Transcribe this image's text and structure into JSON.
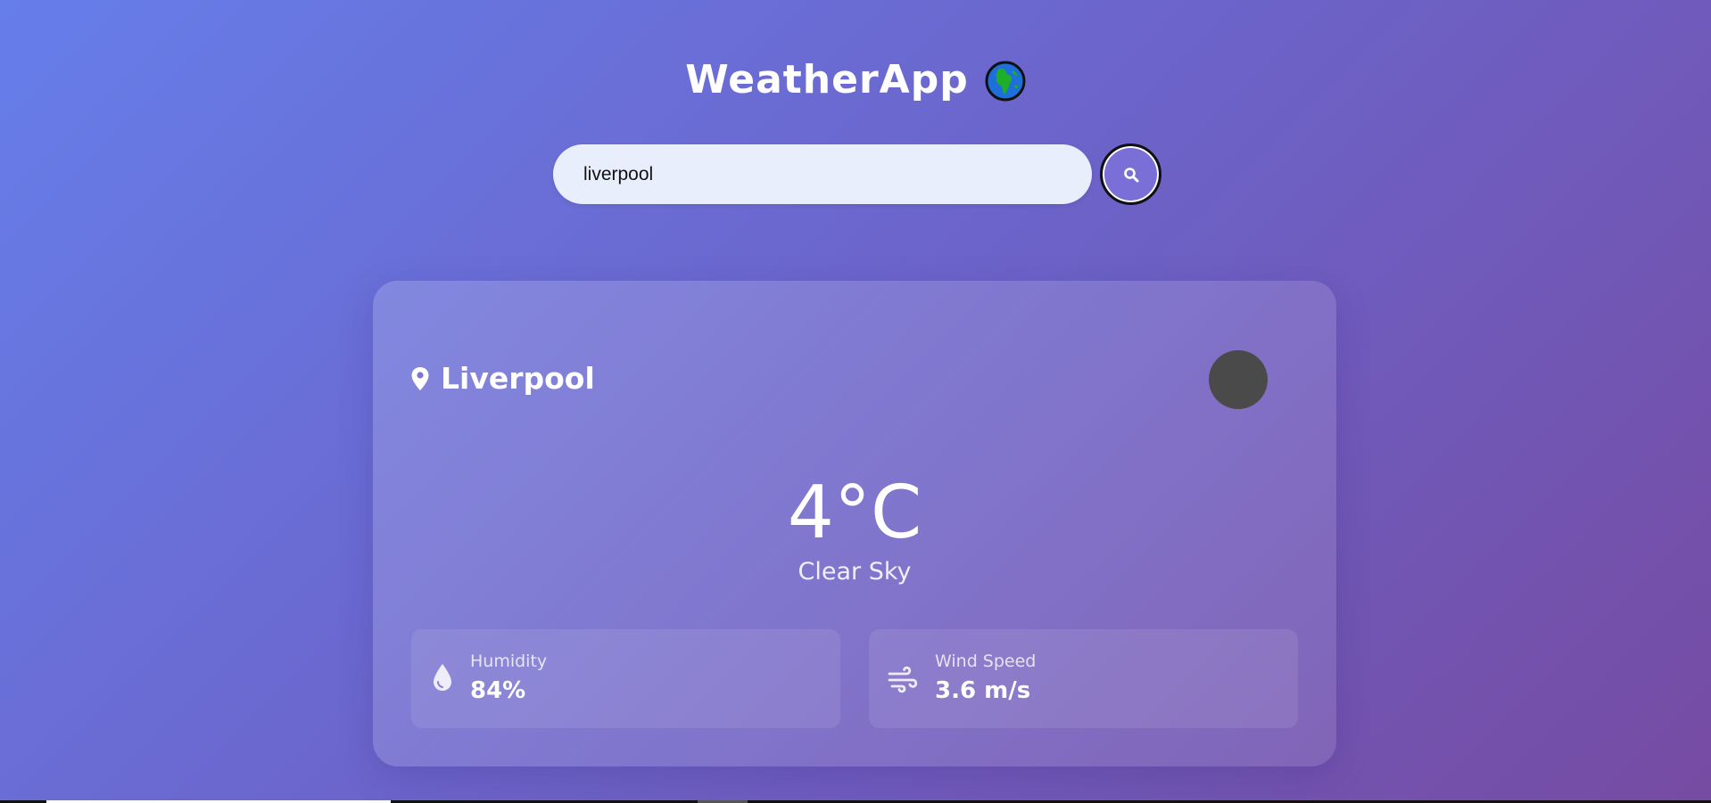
{
  "header": {
    "title": "WeatherApp",
    "icon": "globe-icon"
  },
  "search": {
    "value": "liverpool",
    "button_icon": "search-icon"
  },
  "weather": {
    "location_icon": "map-pin-icon",
    "city": "Liverpool",
    "icon_color": "#4a4a4a",
    "temperature": "4°C",
    "condition": "Clear Sky",
    "humidity": {
      "icon": "water-drop-icon",
      "label": "Humidity",
      "value": "84%"
    },
    "wind": {
      "icon": "wind-icon",
      "label": "Wind Speed",
      "value": "3.6 m/s"
    }
  },
  "colors": {
    "background_start": "#667eea",
    "background_end": "#764ba2",
    "input_background": "#e8eefb",
    "text": "#ffffff"
  }
}
